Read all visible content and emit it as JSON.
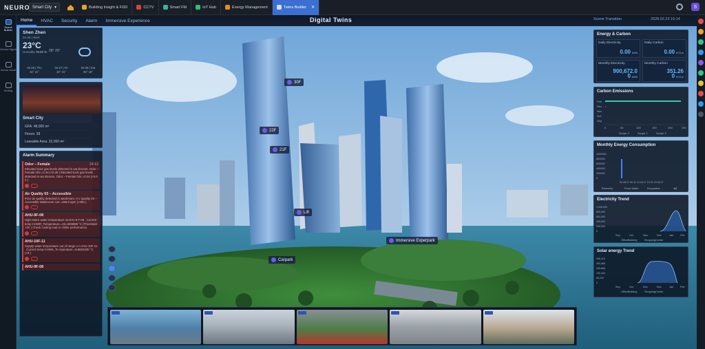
{
  "topbar": {
    "logo": "NEURON",
    "workspace": "Smart City",
    "tabs": [
      {
        "label": "Building Insight & FDD",
        "color": "#e3a629"
      },
      {
        "label": "CCTV",
        "color": "#d6453a"
      },
      {
        "label": "Smart FM",
        "color": "#3bb3a0"
      },
      {
        "label": "IoT Hub",
        "color": "#2fbf77"
      },
      {
        "label": "Energy Management",
        "color": "#e88c2a"
      },
      {
        "label": "Twins Builder",
        "color": "#7ab2ff",
        "active": true
      }
    ],
    "avatar_initial": "S"
  },
  "rail": {
    "items": [
      {
        "label": "Scene Builder",
        "active": true
      },
      {
        "label": "Device Mgmt"
      },
      {
        "label": "Scene Asset"
      },
      {
        "label": "Setting"
      }
    ]
  },
  "subnav": {
    "items": [
      "Home",
      "HVAC",
      "Security",
      "Alarm",
      "Immersive Experience"
    ],
    "active": "Home",
    "title": "Digital Twins",
    "scene_transition": "Scene Transition",
    "datetime": "2028.02.23 16:14"
  },
  "weather": {
    "city": "Shen Zhen",
    "date": "02-25 | Wed",
    "temp": "23°C",
    "range": "28° 20°",
    "humidity_label": "Humidity",
    "humidity": "78.00 %",
    "forecast": [
      {
        "day": "02-26 | Thu",
        "hi": "34°",
        "lo": "21°"
      },
      {
        "day": "02-27 | Fri",
        "hi": "33°",
        "lo": "21°"
      },
      {
        "day": "02-28 | Sat",
        "hi": "30°",
        "lo": "18°"
      }
    ]
  },
  "city": {
    "name": "Smart City",
    "gfa": "GFA: 48,000 m²",
    "floors": "Floors: 38",
    "leasable": "Leasable Area: 32,000 m²"
  },
  "alarms": {
    "title": "Alarm Summary",
    "items": [
      {
        "title": "Odor – Female",
        "time": "14:12",
        "body": "Elevated toxic gas levels detected in wa shroom. Odor – Female nh3 =0.34 (<0.38 ) Elevated toxic gas levels detected in wa shroom. Odor – Female h2s =0.04 (<0.0 2 )"
      },
      {
        "title": "Air Quality 03 – Accessible",
        "body": "Poor air quality detected in washroom. Ai r Quality 03 – Accessible Washroom co2 =458.0 ppm (<450 )"
      },
      {
        "title": "AHU-9F-08",
        "body": "High return water temperature onAHU-9 F-08 . Current temp CHWR_Temperature =23.1839999 °C (Threshold >22 ) Check cooling load or chiller performance."
      },
      {
        "title": "AHU-10F-11",
        "body": "Supply water temperature out of range o n AHU-10F-11 . Current temp CHWS_Te mperature =8.8683330 °C (<8 )"
      }
    ],
    "next_peek": "AHU-9F-08"
  },
  "energy": {
    "title": "Energy & Carbon",
    "boxes": [
      {
        "label": "Daily Electricity",
        "value": "0.00",
        "unit": "kWh"
      },
      {
        "label": "Daily Carbon",
        "value": "0.00",
        "unit": "tCO₂e"
      },
      {
        "label": "Monthly Electricity",
        "value": "900,672.0",
        "value2": "0",
        "unit": "kWh"
      },
      {
        "label": "Monthly Carbon",
        "value": "351.26",
        "value2": "0",
        "unit": "tCO₂e"
      }
    ]
  },
  "carbon": {
    "title": "Carbon Emissions",
    "months": [
      "Feb",
      "Dec",
      "Nov",
      "Oct",
      "Sep"
    ],
    "ticks": [
      "0",
      "50",
      "100",
      "150",
      "200",
      "250"
    ],
    "legend": [
      "Scope 3",
      "Scope 1",
      "Scope 2"
    ]
  },
  "monthly": {
    "title": "Monthly Energy Consumption",
    "yticks": [
      "1000000",
      "800000",
      "600000",
      "400000",
      "200000",
      "0"
    ],
    "xticks": "03 05 07 09 11 13 15 17 19 21 23 25 27",
    "legend": [
      "Electricity",
      "Fresh Water",
      "Recyclable"
    ],
    "page": "1/2"
  },
  "etrend": {
    "title": "Electricity Trend",
    "yticks": [
      "1,000,000",
      "800,000",
      "600,000",
      "400,000",
      "200,000",
      "0"
    ],
    "xticks": [
      "Sep",
      "Oct",
      "Nov",
      "Dec",
      "Jan",
      "Feb"
    ],
    "legend": [
      "OfficeBuilding",
      "ShoppingCenter"
    ]
  },
  "solar": {
    "title": "Solar energy Trend",
    "yticks": [
      "326,110",
      "260,888",
      "195,666",
      "130,444",
      "65,222",
      "0"
    ],
    "xticks": [
      "Sep",
      "Oct",
      "Nov",
      "Dec",
      "Jan",
      "Feb"
    ],
    "legend": [
      "OfficeBuilding",
      "ShoppingCenter"
    ]
  },
  "labels": {
    "floor30": "30F",
    "floor22": "22F",
    "floor21": "21F",
    "lift": "Lift",
    "carpark": "Carpark",
    "immersive": "Immersive Experpark"
  }
}
